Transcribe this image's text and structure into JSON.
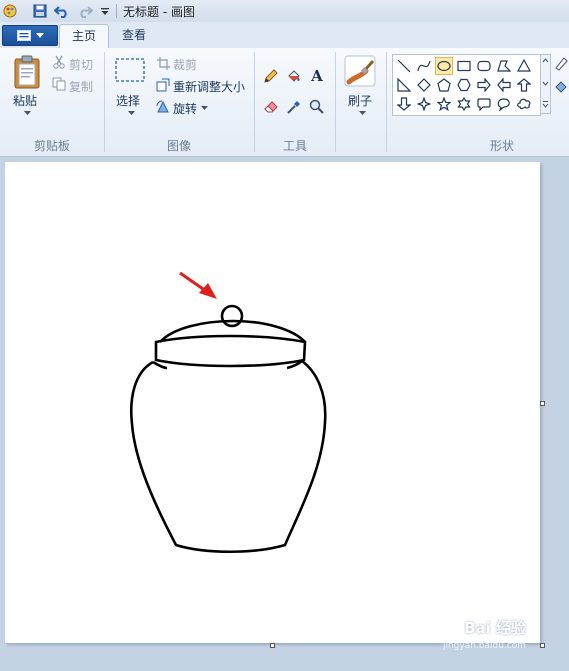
{
  "window": {
    "title": "无标题 - 画图"
  },
  "tabs": {
    "home": "主页",
    "view": "查看"
  },
  "clipboard": {
    "paste": "粘贴",
    "cut": "剪切",
    "copy": "复制",
    "group": "剪贴板"
  },
  "image": {
    "select": "选择",
    "crop": "裁剪",
    "resize": "重新调整大小",
    "rotate": "旋转",
    "group": "图像"
  },
  "tools": {
    "group": "工具",
    "text_glyph": "A"
  },
  "brushes": {
    "label": "刷子"
  },
  "shapes": {
    "group": "形状"
  },
  "watermark": {
    "text": "Bai 经验",
    "sub": "jingyan.baidu.com"
  },
  "colors": {
    "accent": "#1b4f99",
    "arrow": "#e02020",
    "selection": "#fde9a3"
  }
}
